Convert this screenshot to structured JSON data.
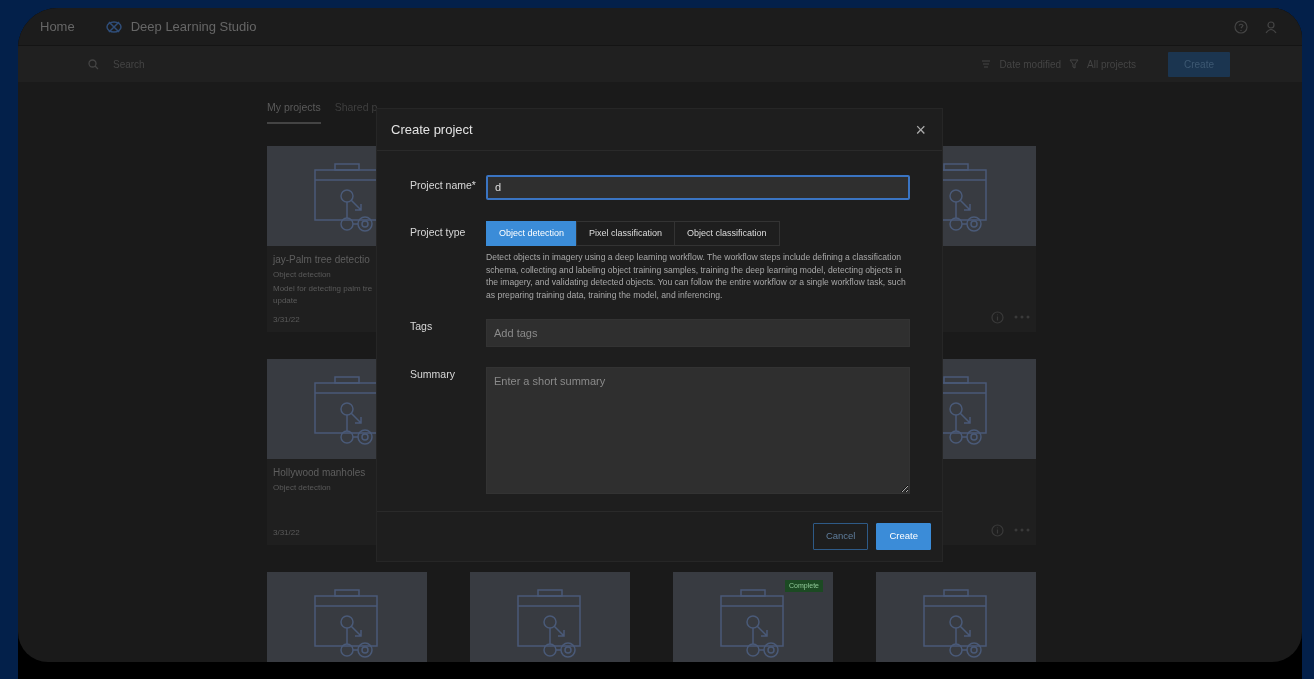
{
  "header": {
    "home_menu": "Home",
    "app_title": "Deep Learning Studio"
  },
  "toolbar": {
    "search_placeholder": "Search",
    "sort": "Date modified",
    "filter": "All projects",
    "create": "Create"
  },
  "tabs": [
    {
      "label": "My projects",
      "selected": true
    },
    {
      "label": "Shared p",
      "selected": false
    }
  ],
  "cards": [
    {
      "kind": "full",
      "title": "jay-Palm tree detectio",
      "type": "Object detection",
      "description": "Model for detecting palm tre update",
      "date": "3/31/22"
    },
    {
      "kind": "covered"
    },
    {
      "kind": "covered"
    },
    {
      "kind": "actions"
    },
    {
      "kind": "full",
      "title": "Hollywood manholes",
      "type": "Object detection",
      "date": "3/31/22"
    },
    {
      "kind": "covered"
    },
    {
      "kind": "covered"
    },
    {
      "kind": "actions"
    },
    {
      "kind": "thumb"
    },
    {
      "kind": "thumb"
    },
    {
      "kind": "thumb",
      "status": "Complete"
    },
    {
      "kind": "thumb"
    }
  ],
  "modal": {
    "title": "Create project",
    "close": "×",
    "project_name": {
      "label": "Project name*",
      "value": "d"
    },
    "project_type": {
      "label": "Project type",
      "options": [
        {
          "label": "Object detection",
          "selected": true
        },
        {
          "label": "Pixel classification",
          "selected": false
        },
        {
          "label": "Object classification",
          "selected": false
        }
      ],
      "description": "Detect objects in imagery using a deep learning workflow. The workflow steps include defining a classification schema, collecting and labeling object training samples, training the deep learning model, detecting objects in the imagery, and validating detected objects. You can follow the entire workflow or a single workflow task, such as preparing training data, training the model, and inferencing."
    },
    "tags": {
      "label": "Tags",
      "placeholder": "Add tags"
    },
    "summary": {
      "label": "Summary",
      "placeholder": "Enter a short summary"
    },
    "buttons": [
      {
        "kind": "secondary",
        "label": "Cancel"
      },
      {
        "kind": "primary",
        "label": "Create"
      }
    ]
  }
}
